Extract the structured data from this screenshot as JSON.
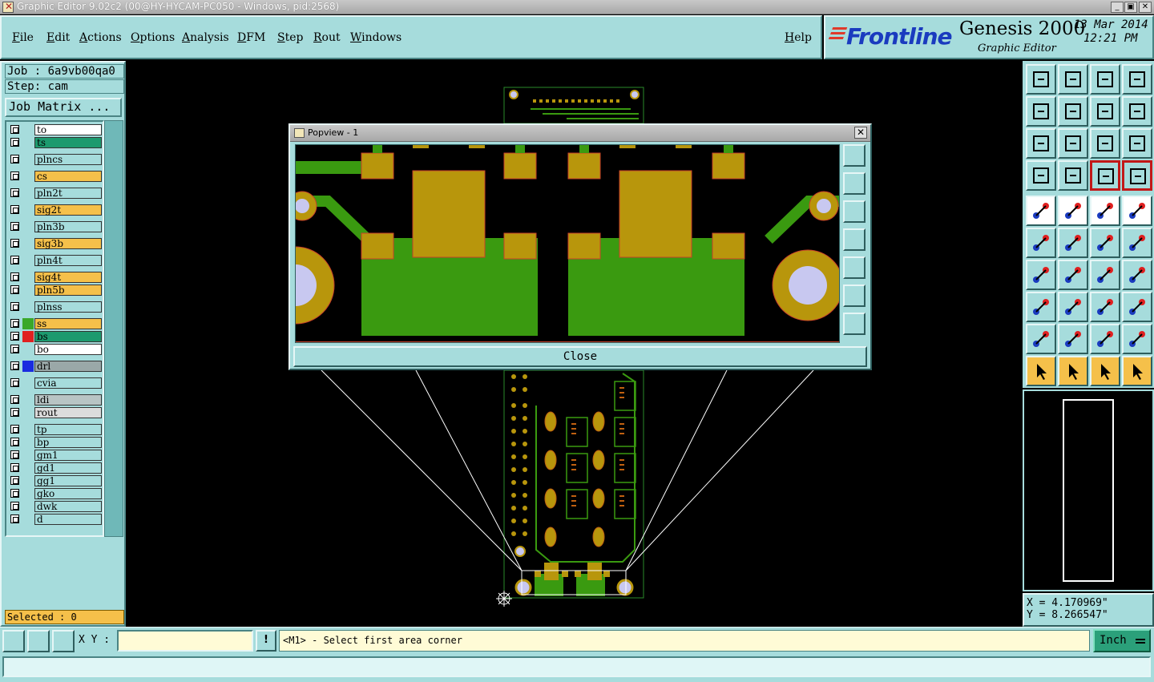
{
  "window": {
    "title": "Graphic Editor 9.02c2 (00@HY-HYCAM-PC050 - Windows, pid:2568)",
    "buttons": [
      "_",
      "▣",
      "✕"
    ]
  },
  "menu": [
    "File",
    "Edit",
    "Actions",
    "Options",
    "Analysis",
    "DFM",
    "Step",
    "Rout",
    "Windows"
  ],
  "help_label": "Help",
  "brand": {
    "logo": "Frontline",
    "product": "Genesis 2000",
    "subtitle": "Graphic Editor",
    "date": "13 Mar 2014",
    "time": "12:21 PM"
  },
  "job": {
    "job_line": "Job : 6a9vb00qa0",
    "step_line": "Step: cam",
    "matrix_button": "Job Matrix ..."
  },
  "layers": [
    {
      "name": "to",
      "color": "#ffffff",
      "swatch": ""
    },
    {
      "name": "ts",
      "color": "#1c9a6e",
      "swatch": ""
    },
    {
      "name": "plncs",
      "color": "#a6dcdc",
      "swatch": ""
    },
    {
      "name": "cs",
      "color": "#f5c04a",
      "swatch": ""
    },
    {
      "name": "pln2t",
      "color": "#a6dcdc",
      "swatch": ""
    },
    {
      "name": "sig2t",
      "color": "#f5c04a",
      "swatch": ""
    },
    {
      "name": "pln3b",
      "color": "#a6dcdc",
      "swatch": ""
    },
    {
      "name": "sig3b",
      "color": "#f5c04a",
      "swatch": ""
    },
    {
      "name": "pln4t",
      "color": "#a6dcdc",
      "swatch": ""
    },
    {
      "name": "sig4t",
      "color": "#f5c04a",
      "swatch": ""
    },
    {
      "name": "pln5b",
      "color": "#f5c04a",
      "swatch": ""
    },
    {
      "name": "plnss",
      "color": "#a6dcdc",
      "swatch": ""
    },
    {
      "name": "ss",
      "color": "#f5c04a",
      "swatch": "#3aa82a"
    },
    {
      "name": "bs",
      "color": "#1c9a6e",
      "swatch": "#e02020"
    },
    {
      "name": "bo",
      "color": "#ffffff",
      "swatch": ""
    },
    {
      "name": "drl",
      "color": "#9aa8a8",
      "swatch": "#1a2be0"
    },
    {
      "name": "cvia",
      "color": "#a6dcdc",
      "swatch": ""
    },
    {
      "name": "ldi",
      "color": "#b8c4c4",
      "swatch": ""
    },
    {
      "name": "rout",
      "color": "#dcdcdc",
      "swatch": ""
    },
    {
      "name": "tp",
      "color": "#a6dcdc",
      "swatch": ""
    },
    {
      "name": "bp",
      "color": "#a6dcdc",
      "swatch": ""
    },
    {
      "name": "gm1",
      "color": "#a6dcdc",
      "swatch": ""
    },
    {
      "name": "gd1",
      "color": "#a6dcdc",
      "swatch": ""
    },
    {
      "name": "gg1",
      "color": "#a6dcdc",
      "swatch": ""
    },
    {
      "name": "gko",
      "color": "#a6dcdc",
      "swatch": ""
    },
    {
      "name": "dwk",
      "color": "#a6dcdc",
      "swatch": ""
    },
    {
      "name": "d",
      "color": "#a6dcdc",
      "swatch": ""
    }
  ],
  "selected_label": "Selected : 0",
  "popview": {
    "title": "Popview - 1",
    "close_label": "Close"
  },
  "coords": {
    "x": "X = 4.170969\"",
    "y": "Y = 8.266547\""
  },
  "bottom": {
    "xy_label": "X Y :",
    "xy_value": "",
    "excl": "!",
    "prompt": "<M1> - Select first area corner",
    "units": "Inch"
  },
  "colors": {
    "copper": "#b8960c",
    "green": "#3a9a10",
    "panel": "#a6dcdc",
    "drill": "#c8c8f0"
  }
}
